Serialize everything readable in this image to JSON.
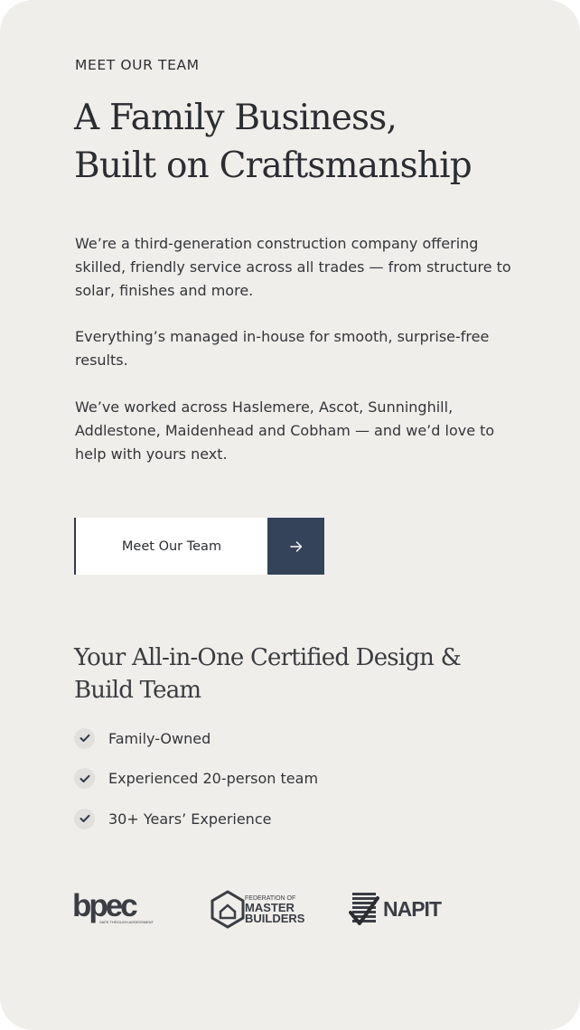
{
  "eyebrow": "MEET OUR TEAM",
  "headline": {
    "line1": "A Family Business,",
    "line2": "Built on Craftsmanship"
  },
  "paragraphs": [
    "We’re a third-generation construction company offering skilled, friendly service across all trades — from structure to solar, finishes and more.",
    "Everything’s managed in-house for smooth, surprise-free results.",
    "We’ve worked across Haslemere, Ascot, Sunninghill, Addlestone, Maidenhead and Cobham — and we’d love to help with yours next."
  ],
  "cta": {
    "label": "Meet Our Team",
    "icon": "arrow-right-icon"
  },
  "subhead": {
    "line1": "Your All-in-One Certified Design &",
    "line2": "Build Team"
  },
  "features": [
    {
      "label": "Family-Owned",
      "icon": "check-icon"
    },
    {
      "label": "Experienced 20-person team",
      "icon": "check-icon"
    },
    {
      "label": "30+ Years’ Experience",
      "icon": "check-icon"
    }
  ],
  "logos": {
    "bpec": {
      "name": "bpec",
      "tagline": "SAFE THROUGH ASSESSMENT"
    },
    "fmb": {
      "top": "FEDERATION OF",
      "line1": "MASTER",
      "line2": "BUILDERS"
    },
    "napit": {
      "name": "NAPIT"
    }
  },
  "colors": {
    "background": "#f0eeeb",
    "accent": "#35435a",
    "text": "#2b2d31"
  }
}
